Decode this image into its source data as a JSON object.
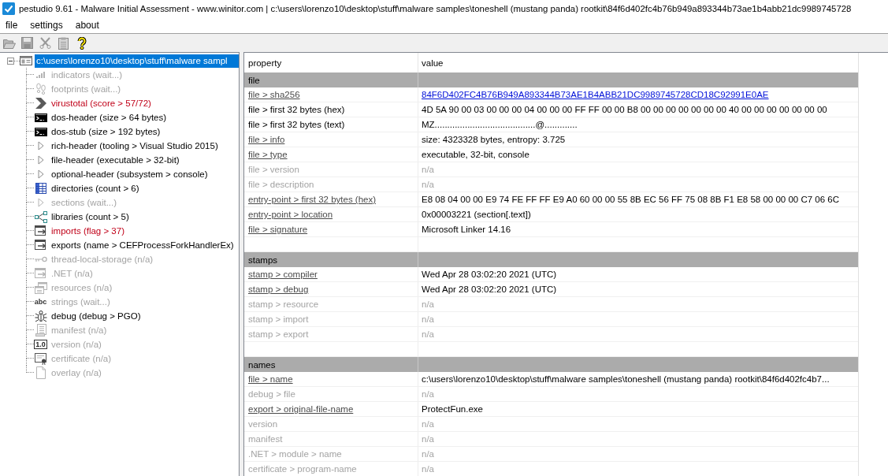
{
  "window": {
    "title": "pestudio 9.61 - Malware Initial Assessment - www.winitor.com | c:\\users\\lorenzo10\\desktop\\stuff\\malware samples\\toneshell (mustang panda) rootkit\\84f6d402fc4b76b949a893344b73ae1b4abb21dc9989745728"
  },
  "menu": [
    "file",
    "settings",
    "about"
  ],
  "toolbar": [
    {
      "disabled": true
    },
    {
      "disabled": true
    },
    {
      "disabled": true
    },
    {
      "disabled": true
    },
    {
      "disabled": false
    }
  ],
  "tree": {
    "label": "c:\\users\\lorenzo10\\desktop\\stuff\\malware sampl",
    "selected": true,
    "expanded": true,
    "children": [
      {
        "label": "indicators (wait...)",
        "selected": false,
        "disabled": true,
        "flagged": false
      },
      {
        "label": "footprints (wait...)",
        "selected": false,
        "disabled": true,
        "flagged": false
      },
      {
        "label": "virustotal (score > 57/72)",
        "selected": false,
        "disabled": false,
        "flagged": true
      },
      {
        "label": "dos-header (size > 64 bytes)",
        "selected": false,
        "disabled": false,
        "flagged": false
      },
      {
        "label": "dos-stub (size > 192 bytes)",
        "selected": false,
        "disabled": false,
        "flagged": false
      },
      {
        "label": "rich-header (tooling > Visual Studio 2015)",
        "selected": false,
        "disabled": false,
        "flagged": false
      },
      {
        "label": "file-header (executable > 32-bit)",
        "selected": false,
        "disabled": false,
        "flagged": false
      },
      {
        "label": "optional-header (subsystem > console)",
        "selected": false,
        "disabled": false,
        "flagged": false
      },
      {
        "label": "directories (count > 6)",
        "selected": false,
        "disabled": false,
        "flagged": false
      },
      {
        "label": "sections (wait...)",
        "selected": false,
        "disabled": true,
        "flagged": false
      },
      {
        "label": "libraries (count > 5)",
        "selected": false,
        "disabled": false,
        "flagged": false
      },
      {
        "label": "imports (flag > 37)",
        "selected": false,
        "disabled": false,
        "flagged": true
      },
      {
        "label": "exports (name > CEFProcessForkHandlerEx)",
        "selected": false,
        "disabled": false,
        "flagged": false
      },
      {
        "label": "thread-local-storage (n/a)",
        "selected": false,
        "disabled": true,
        "flagged": false
      },
      {
        "label": ".NET (n/a)",
        "selected": false,
        "disabled": true,
        "flagged": false
      },
      {
        "label": "resources (n/a)",
        "selected": false,
        "disabled": true,
        "flagged": false
      },
      {
        "label": "strings (wait...)",
        "selected": false,
        "disabled": true,
        "flagged": false,
        "icon_text": "abc"
      },
      {
        "label": "debug (debug > PGO)",
        "selected": false,
        "disabled": false,
        "flagged": false
      },
      {
        "label": "manifest (n/a)",
        "selected": false,
        "disabled": true,
        "flagged": false
      },
      {
        "label": "version (n/a)",
        "selected": false,
        "disabled": true,
        "flagged": false,
        "icon_text": "1.0"
      },
      {
        "label": "certificate (n/a)",
        "selected": false,
        "disabled": true,
        "flagged": false
      },
      {
        "label": "overlay (n/a)",
        "selected": false,
        "disabled": true,
        "flagged": false
      }
    ]
  },
  "table": {
    "columns": [
      "property",
      "value"
    ],
    "sections": [
      {
        "title": "file",
        "rows": [
          {
            "property": "file > sha256",
            "value": "84F6D402FC4B76B949A893344B73AE1B4ABB21DC9989745728CD18C92991E0AE",
            "underlined": true,
            "disabled": false,
            "link": true
          },
          {
            "property": "file > first 32 bytes (hex)",
            "value": "4D 5A 90 00 03 00 00 00 04 00 00 00 FF FF 00 00 B8 00 00 00 00 00 00 00 40 00 00 00 00 00 00 00",
            "underlined": false,
            "disabled": false,
            "link": false
          },
          {
            "property": "file > first 32 bytes (text)",
            "value": "MZ........................................@.............",
            "underlined": false,
            "disabled": false,
            "link": false
          },
          {
            "property": "file > info",
            "value": "size: 4323328 bytes, entropy: 3.725",
            "underlined": true,
            "disabled": false,
            "link": false
          },
          {
            "property": "file > type",
            "value": "executable, 32-bit, console",
            "underlined": true,
            "disabled": false,
            "link": false
          },
          {
            "property": "file > version",
            "value": "n/a",
            "underlined": false,
            "disabled": true,
            "link": false
          },
          {
            "property": "file > description",
            "value": "n/a",
            "underlined": false,
            "disabled": true,
            "link": false
          },
          {
            "property": "entry-point > first 32 bytes (hex)",
            "value": "E8 08 04 00 00 E9 74 FE FF FF E9 A0 60 00 00 55 8B EC 56 FF 75 08 8B F1 E8 58 00 00 00 C7 06 6C",
            "underlined": true,
            "disabled": false,
            "link": false
          },
          {
            "property": "entry-point > location",
            "value": "0x00003221 (section[.text])",
            "underlined": true,
            "disabled": false,
            "link": false
          },
          {
            "property": "file > signature",
            "value": "Microsoft Linker 14.16",
            "underlined": true,
            "disabled": false,
            "link": false
          }
        ]
      },
      {
        "title": "stamps",
        "rows": [
          {
            "property": "stamp > compiler",
            "value": "Wed Apr 28 03:02:20 2021 (UTC)",
            "underlined": true,
            "disabled": false,
            "link": false
          },
          {
            "property": "stamp > debug",
            "value": "Wed Apr 28 03:02:20 2021 (UTC)",
            "underlined": true,
            "disabled": false,
            "link": false
          },
          {
            "property": "stamp > resource",
            "value": "n/a",
            "underlined": false,
            "disabled": true,
            "link": false
          },
          {
            "property": "stamp > import",
            "value": "n/a",
            "underlined": false,
            "disabled": true,
            "link": false
          },
          {
            "property": "stamp > export",
            "value": "n/a",
            "underlined": false,
            "disabled": true,
            "link": false
          }
        ]
      },
      {
        "title": "names",
        "rows": [
          {
            "property": "file > name",
            "value": "c:\\users\\lorenzo10\\desktop\\stuff\\malware samples\\toneshell (mustang panda) rootkit\\84f6d402fc4b7...",
            "underlined": true,
            "disabled": false,
            "link": false
          },
          {
            "property": "debug > file",
            "value": "n/a",
            "underlined": false,
            "disabled": true,
            "link": false
          },
          {
            "property": "export > original-file-name",
            "value": "ProtectFun.exe",
            "underlined": true,
            "disabled": false,
            "link": false
          },
          {
            "property": "version",
            "value": "n/a",
            "underlined": false,
            "disabled": true,
            "link": false
          },
          {
            "property": "manifest",
            "value": "n/a",
            "underlined": false,
            "disabled": true,
            "link": false
          },
          {
            "property": ".NET > module > name",
            "value": "n/a",
            "underlined": false,
            "disabled": true,
            "link": false
          },
          {
            "property": "certificate > program-name",
            "value": "n/a",
            "underlined": false,
            "disabled": true,
            "link": false
          }
        ]
      }
    ]
  }
}
